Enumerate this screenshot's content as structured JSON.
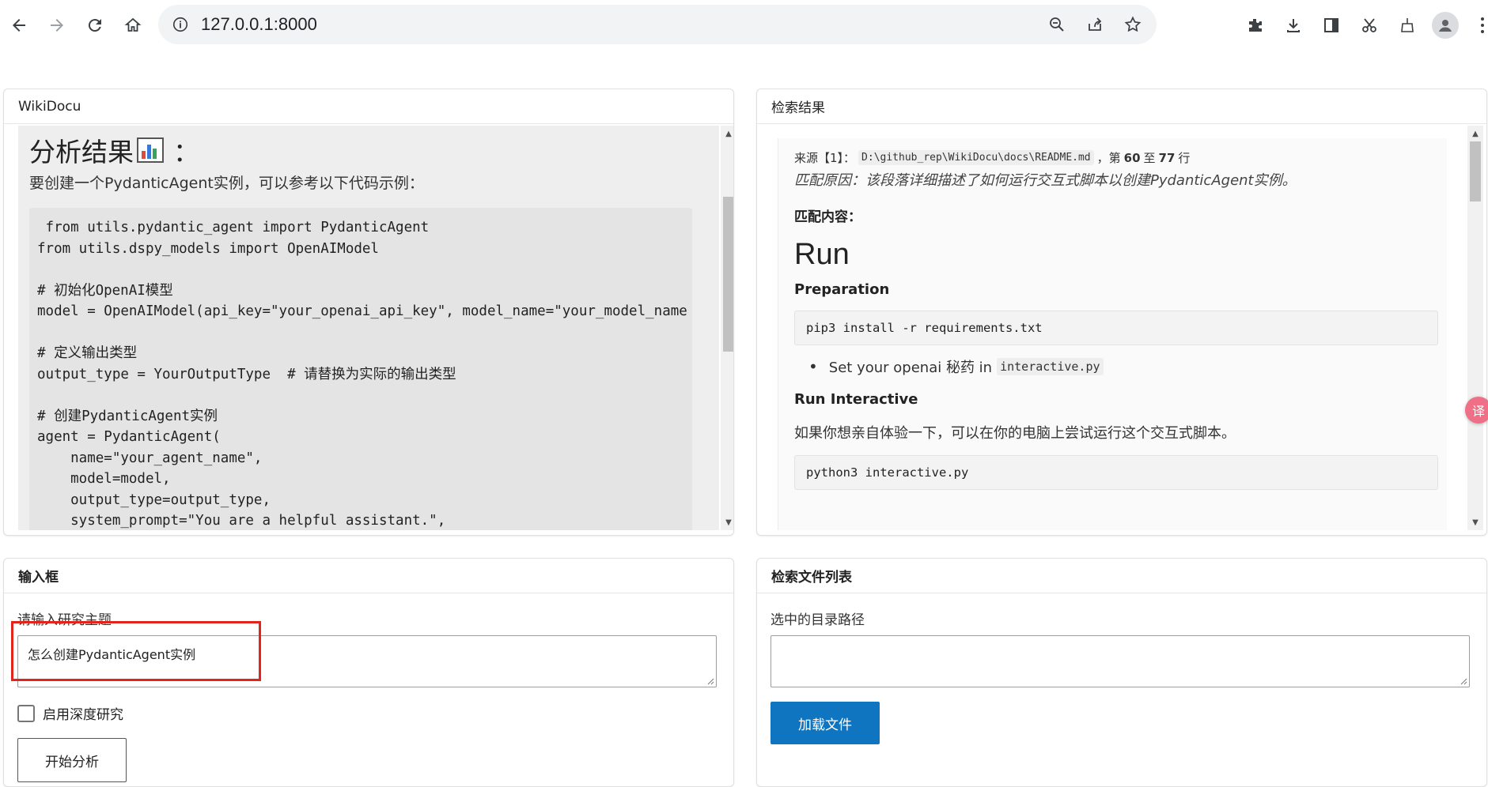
{
  "browser": {
    "url": "127.0.0.1:8000"
  },
  "wiki_panel": {
    "title": "WikiDocu",
    "heading": "分析结果",
    "heading_suffix": "：",
    "description": "要创建一个PydanticAgent实例，可以参考以下代码示例：",
    "code": " from utils.pydantic_agent import PydanticAgent\nfrom utils.dspy_models import OpenAIModel\n\n# 初始化OpenAI模型\nmodel = OpenAIModel(api_key=\"your_openai_api_key\", model_name=\"your_model_name\n\n# 定义输出类型\noutput_type = YourOutputType  # 请替换为实际的输出类型\n\n# 创建PydanticAgent实例\nagent = PydanticAgent(\n    name=\"your_agent_name\",\n    model=model,\n    output_type=output_type,\n    system_prompt=\"You are a helpful assistant.\","
  },
  "search_panel": {
    "title": "检索结果",
    "source_prefix": "来源【1】：",
    "source_path": "D:\\github_rep\\WikiDocu\\docs\\README.md",
    "source_sep": "，第",
    "line_start": "60",
    "line_to": "至",
    "line_end": "77",
    "line_suffix": "行",
    "match_reason": "匹配原因：该段落详细描述了如何运行交互式脚本以创建PydanticAgent实例。",
    "match_label": "匹配内容：",
    "run_heading": "Run",
    "prep_heading": "Preparation",
    "cmd_install": "pip3 install -r requirements.txt",
    "bullet_text": "Set your openai 秘药 in",
    "bullet_code": "interactive.py",
    "run_interactive_heading": "Run Interactive",
    "para": "如果你想亲自体验一下，可以在你的电脑上尝试运行这个交互式脚本。",
    "cmd_run": "python3 interactive.py"
  },
  "input_panel": {
    "title": "输入框",
    "topic_label": "请输入研究主题",
    "topic_value": "怎么创建PydanticAgent实例",
    "deep_research_label": "启用深度研究",
    "deep_research_checked": false,
    "start_button": "开始分析"
  },
  "files_panel": {
    "title": "检索文件列表",
    "path_label": "选中的目录路径",
    "path_value": "",
    "load_button": "加载文件"
  },
  "colors": {
    "accent_button": "#0f75c0",
    "highlight": "#e1251b",
    "translate_badge": "#ee6f86"
  }
}
